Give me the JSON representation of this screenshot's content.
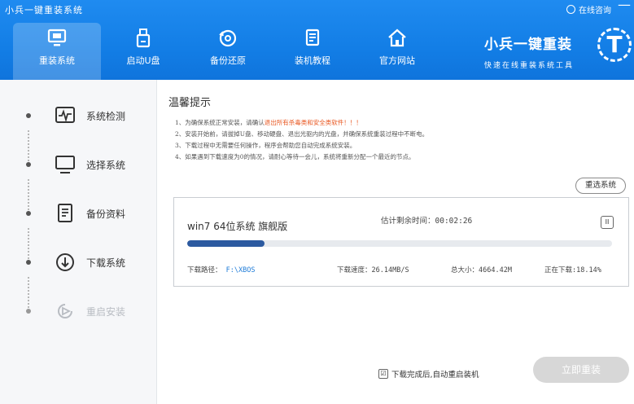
{
  "app": {
    "title": "小兵一键重装系统"
  },
  "header": {
    "consult_label": "在线咨询",
    "minimize_label": "—",
    "nav": [
      {
        "label": "重装系统",
        "icon": "monitor-icon",
        "active": true
      },
      {
        "label": "启动U盘",
        "icon": "usb-drive-icon",
        "active": false
      },
      {
        "label": "备份还原",
        "icon": "backup-disc-icon",
        "active": false
      },
      {
        "label": "装机教程",
        "icon": "document-icon",
        "active": false
      },
      {
        "label": "官方网站",
        "icon": "home-icon",
        "active": false
      }
    ],
    "brand_name": "小兵一键重装",
    "brand_slogan": "快速在线重装系统工具",
    "logo_glyph": "T"
  },
  "sidebar": {
    "steps": [
      {
        "label": "系统检测",
        "icon": "pulse-icon",
        "enabled": true
      },
      {
        "label": "选择系统",
        "icon": "monitor-icon",
        "enabled": true
      },
      {
        "label": "备份资料",
        "icon": "document-icon",
        "enabled": true
      },
      {
        "label": "下载系统",
        "icon": "download-icon",
        "enabled": true
      },
      {
        "label": "重启安装",
        "icon": "restart-icon",
        "enabled": false
      }
    ]
  },
  "main": {
    "tips_title": "温馨提示",
    "tips": [
      {
        "pre": "1、为确保系统正常安装，请确认",
        "warn": "退出所有杀毒类和安全类软件！！！",
        "post": ""
      },
      {
        "pre": "2、安装开始前，请拔掉U盘、移动硬盘、退出光驱内的光盘，并确保系统重装过程中不断电。",
        "warn": "",
        "post": ""
      },
      {
        "pre": "3、下载过程中无需要任何操作，程序会帮助您自动完成系统安装。",
        "warn": "",
        "post": ""
      },
      {
        "pre": "4、如果遇到下载速度为0的情况，请耐心等待一会儿，系统将重新分配一个最近的节点。",
        "warn": "",
        "post": ""
      }
    ],
    "reselect_label": "重选系统",
    "download": {
      "os_name": "win7 64位系统 旗舰版",
      "eta_label": "估计剩余时间：00:02:26",
      "pause_label": "II",
      "progress": 0.1814,
      "path_label": "下载路径：",
      "path_value": "F:\\XBOS",
      "speed_label": "下载速度：26.14MB/S",
      "size_label": "总大小：4664.42M",
      "status_label": "正在下载:18.14%"
    },
    "auto_restart_label": "下载完成后,自动重启装机",
    "auto_restart_checked": "☑",
    "install_label": "立即重装"
  }
}
